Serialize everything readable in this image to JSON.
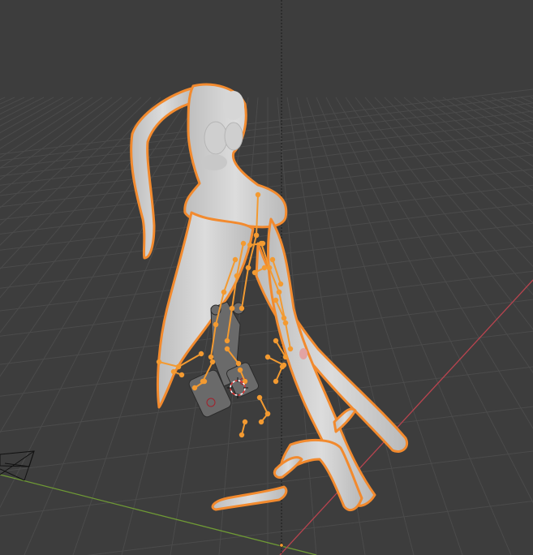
{
  "app": {
    "name": "3D Viewport",
    "view": "perspective"
  },
  "viewport": {
    "background_color": "#3d3d3d",
    "grid_color": "#4a4a4a",
    "x_axis_color": "#b8444f",
    "y_axis_color": "#6f9a35",
    "selection_outline_color": "#f28a2e",
    "mesh_color": "#d3d3d3",
    "bone_color": "#f39a31"
  },
  "scene_objects": [
    {
      "name": "character-mesh",
      "selected": true
    },
    {
      "name": "armature",
      "selected": true
    },
    {
      "name": "camera",
      "selected": false
    },
    {
      "name": "3d-cursor",
      "selected": false
    }
  ]
}
